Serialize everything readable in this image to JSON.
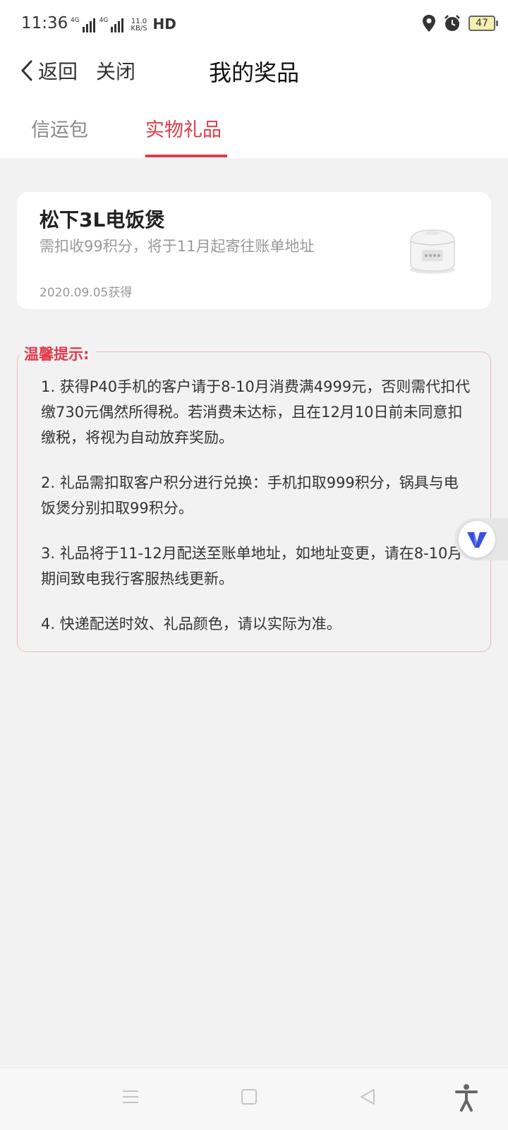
{
  "status_bar": {
    "time": "11:36",
    "network1": "4G",
    "network2": "4G",
    "speed_value": "11.0",
    "speed_unit": "KB/S",
    "hd": "HD",
    "battery": "47",
    "icons": [
      "location-icon",
      "alarm-icon",
      "battery-icon"
    ]
  },
  "nav": {
    "back_label": "返回",
    "close_label": "关闭",
    "title": "我的奖品"
  },
  "tabs": [
    {
      "label": "信运包",
      "active": false
    },
    {
      "label": "实物礼品",
      "active": true
    }
  ],
  "prize": {
    "name": "松下3L电饭煲",
    "description": "需扣收99积分，将于11月起寄往账单地址",
    "date": "2020.09.05获得",
    "image_icon": "rice-cooker-image"
  },
  "notice": {
    "title": "温馨提示:",
    "items": [
      "1. 获得P40手机的客户请于8-10月消费满4999元，否则需代扣代缴730元偶然所得税。若消费未达标，且在12月10日前未同意扣缴税，将视为自动放弃奖励。",
      "2. 礼品需扣取客户积分进行兑换：手机扣取999积分，锅具与电饭煲分别扣取99积分。",
      "3. 礼品将于11-12月配送至账单地址，如地址变更，请在8-10月期间致电我行客服热线更新。",
      "4. 快递配送时效、礼品颜色，请以实际为准。"
    ]
  },
  "colors": {
    "accent": "#e03a4a",
    "background": "#f2f2f2",
    "notice_border": "#f2b8b8",
    "float_logo": "#3a4fe0"
  },
  "bottom_nav": [
    "menu-icon",
    "home-icon",
    "back-triangle-icon",
    "accessibility-icon"
  ]
}
